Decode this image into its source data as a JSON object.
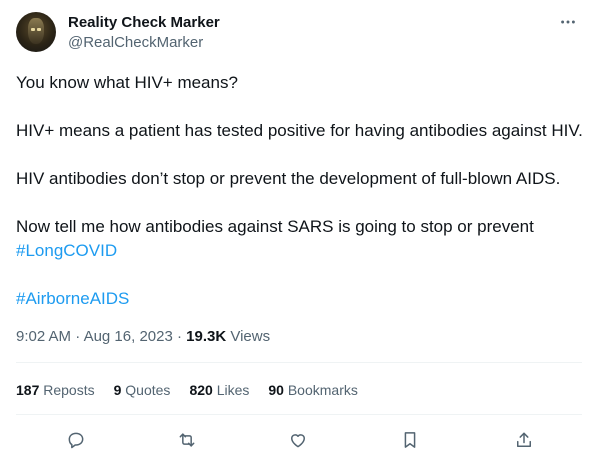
{
  "author": {
    "display_name": "Reality Check Marker",
    "handle": "@RealCheckMarker"
  },
  "more_menu_icon": "more-horizontal-icon",
  "tweet": {
    "paragraphs": [
      "You know what HIV+ means?",
      "HIV+ means a patient has tested positive for having antibodies against HIV.",
      "HIV antibodies don’t stop or prevent the development of full-blown AIDS.",
      "Now tell me how antibodies against SARS is going to stop or prevent"
    ],
    "hashtags": [
      "#LongCOVID",
      "#AirborneAIDS"
    ]
  },
  "meta": {
    "time": "9:02 AM",
    "separator": "·",
    "date": "Aug 16, 2023",
    "views_count": "19.3K",
    "views_label": "Views"
  },
  "stats": {
    "reposts": {
      "count": "187",
      "label": "Reposts"
    },
    "quotes": {
      "count": "9",
      "label": "Quotes"
    },
    "likes": {
      "count": "820",
      "label": "Likes"
    },
    "bookmarks": {
      "count": "90",
      "label": "Bookmarks"
    }
  },
  "actions": [
    "reply-icon",
    "repost-icon",
    "like-icon",
    "bookmark-icon",
    "share-icon"
  ],
  "colors": {
    "text": "#0f1419",
    "secondary": "#536471",
    "link": "#1d9bf0",
    "divider": "#eff3f4"
  }
}
